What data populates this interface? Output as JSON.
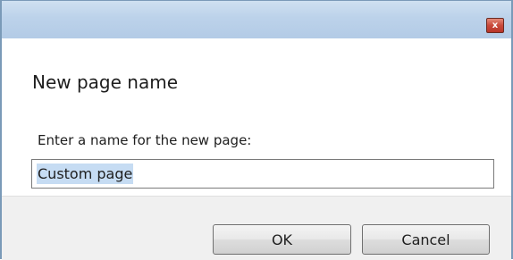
{
  "window": {
    "close_glyph": "x"
  },
  "dialog": {
    "title": "New page name",
    "prompt": "Enter a name for the new page:",
    "input_value": "Custom page"
  },
  "buttons": {
    "ok_label": "OK",
    "cancel_label": "Cancel"
  },
  "icons": {
    "close": "close-icon"
  },
  "colors": {
    "titlebar": "#bcd2ea",
    "close_button": "#c8483a",
    "selection": "#c6dcf3",
    "footer": "#f0f0f0"
  }
}
